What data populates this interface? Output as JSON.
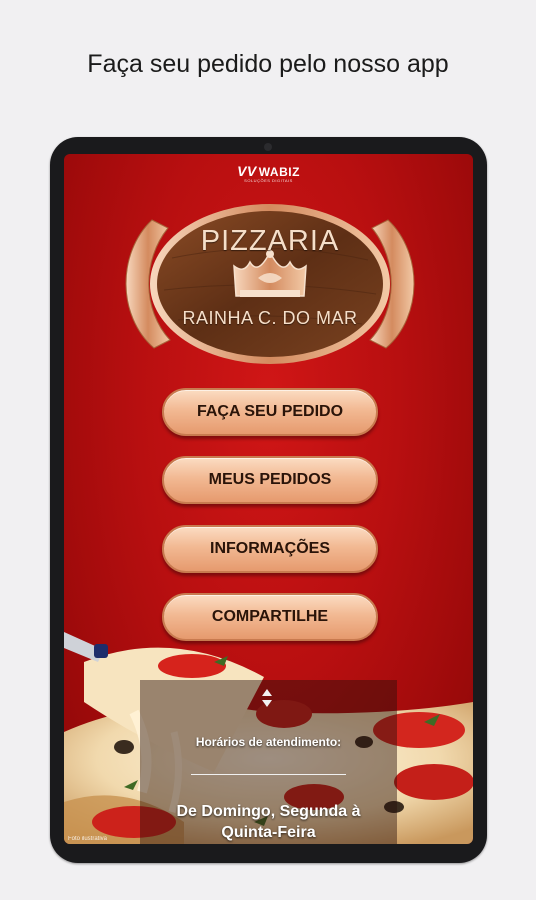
{
  "headline": "Faça seu pedido pelo nosso app",
  "brand": {
    "name": "WABIZ",
    "tagline": "SOLUÇÕES DIGITAIS"
  },
  "logo": {
    "title": "PIZZARIA",
    "subtitle": "RAINHA C. DO MAR"
  },
  "menu": {
    "items": [
      {
        "label": "FAÇA SEU PEDIDO"
      },
      {
        "label": "MEUS PEDIDOS"
      },
      {
        "label": "INFORMAÇÕES"
      },
      {
        "label": "COMPARTILHE"
      }
    ]
  },
  "hours": {
    "title": "Horários de atendimento:",
    "days_line1": "De Domingo, Segunda à",
    "days_line2": "Quinta-Feira"
  },
  "photo_caption": "Foto ilustrativa",
  "colors": {
    "background": "#f1f0f2",
    "screen_red": "#c01212",
    "button_peach": "#f2b993",
    "button_text": "#2a1409",
    "wood": "#6b3a1e"
  },
  "icons": [
    "wabiz-logo-icon",
    "crown-icon",
    "scroll-arrows-icon",
    "pizza-slice-image"
  ]
}
